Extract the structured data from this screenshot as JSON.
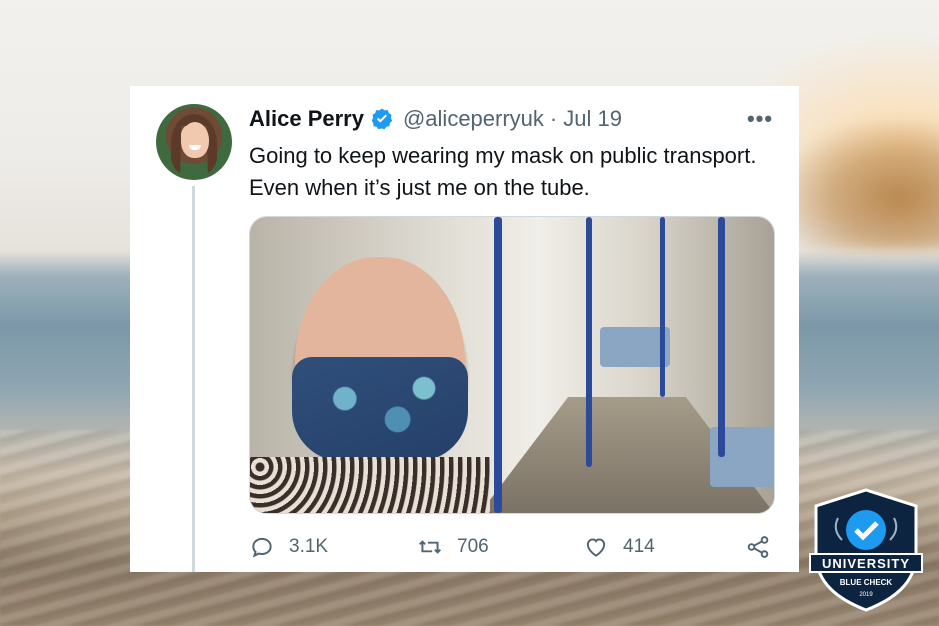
{
  "tweet": {
    "author_name": "Alice Perry",
    "handle": "@aliceperryuk",
    "separator": "·",
    "date": "Jul 19",
    "text_line1": "Going to keep wearing my mask on public transport.",
    "text_line2": "Even when it’s just me on the tube.",
    "more_label": "•••",
    "actions": {
      "replies": "3.1K",
      "retweets": "706",
      "likes": "414"
    }
  },
  "badge": {
    "line1": "UNIVERSITY",
    "line2": "BLUE CHECK",
    "year": "2019"
  },
  "colors": {
    "verified": "#1d9bf0",
    "text_primary": "#0f1419",
    "text_secondary": "#536471"
  }
}
